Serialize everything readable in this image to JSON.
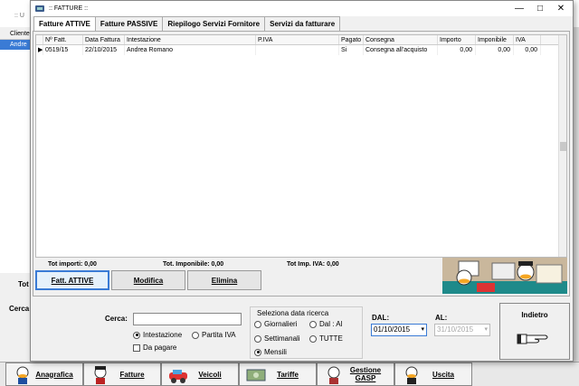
{
  "background": {
    "title": ":: U",
    "grid_header": "Cliente",
    "grid_row": "Andre",
    "tot_label": "Tot",
    "cerca_label": "Cerca:"
  },
  "window": {
    "title": ":: FATTURE ::",
    "controls": {
      "minimize": "—",
      "maximize": "□",
      "close": "✕"
    }
  },
  "tabs": [
    {
      "label": "Fatture ATTIVE",
      "active": true
    },
    {
      "label": "Fatture PASSIVE",
      "active": false
    },
    {
      "label": "Riepilogo Servizi Fornitore",
      "active": false
    },
    {
      "label": "Servizi da fatturare",
      "active": false
    }
  ],
  "grid": {
    "columns": [
      "Nº Fatt.",
      "Data Fattura",
      "Intestazione",
      "P.IVA",
      "Pagato",
      "Consegna",
      "Importo",
      "Imponibile",
      "IVA"
    ],
    "rows": [
      {
        "marker": "▶",
        "num": "0519/15",
        "data": "22/10/2015",
        "intestazione": "Andrea Romano",
        "piva": "",
        "pagato": "Si",
        "consegna": "Consegna all'acquisto",
        "importo": "0,00",
        "imponibile": "0,00",
        "iva": "0,00"
      }
    ]
  },
  "totals": {
    "importi": "Tot importi: 0,00",
    "imponibile": "Tot. Imponibile: 0,00",
    "imp_iva": "Tot Imp. IVA: 0,00"
  },
  "buttons": {
    "fatt_attive": "Fatt. ATTIVE",
    "modifica": "Modifica",
    "elimina": "Elimina"
  },
  "search": {
    "cerca_label": "Cerca:",
    "cerca_value": "",
    "opt_intestazione": "Intestazione",
    "opt_partita_iva": "Partita IVA",
    "da_pagare": "Da pagare",
    "group_title": "Seleziona data ricerca",
    "opt_giornalieri": "Giornalieri",
    "opt_dal_al": "Dal : Al",
    "opt_settimanali": "Settimanali",
    "opt_tutte": "TUTTE",
    "opt_mensili": "Mensili",
    "dal_label": "DAL:",
    "dal_value": "01/10/2015",
    "al_label": "AL:",
    "al_value": "31/10/2015",
    "indietro": "Indietro"
  },
  "bottom_bar": [
    "Anagrafica",
    "Fatture",
    "Veicoli",
    "Tariffe",
    "Gestione GASP",
    "Uscita"
  ],
  "colors": {
    "accent": "#3a7bd5",
    "selected_row": "#3a7bd5"
  }
}
